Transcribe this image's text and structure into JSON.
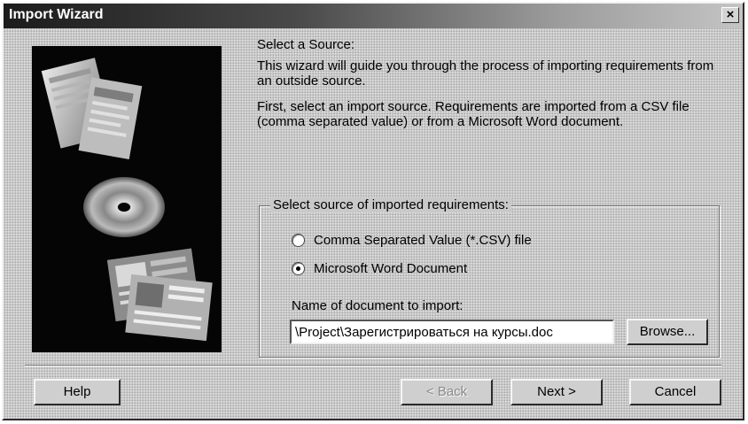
{
  "window": {
    "title": "Import Wizard",
    "close_glyph": "×"
  },
  "content": {
    "heading": "Select a Source:",
    "intro": "This wizard will guide you through the process of importing requirements from an outside source.",
    "instructions": "First, select an import source. Requirements are imported from a CSV file (comma separated value) or from a Microsoft Word document."
  },
  "source_group": {
    "legend": "Select source of imported requirements:",
    "options": [
      {
        "label": "Comma Separated Value (*.CSV) file",
        "checked": false
      },
      {
        "label": "Microsoft Word Document",
        "checked": true
      }
    ],
    "document_label": "Name of document to import:",
    "document_value": "\\Project\\Зарегистрироваться на курсы.doc",
    "browse_label": "Browse..."
  },
  "buttons": {
    "help": "Help",
    "back": "< Back",
    "next": "Next >",
    "cancel": "Cancel"
  }
}
